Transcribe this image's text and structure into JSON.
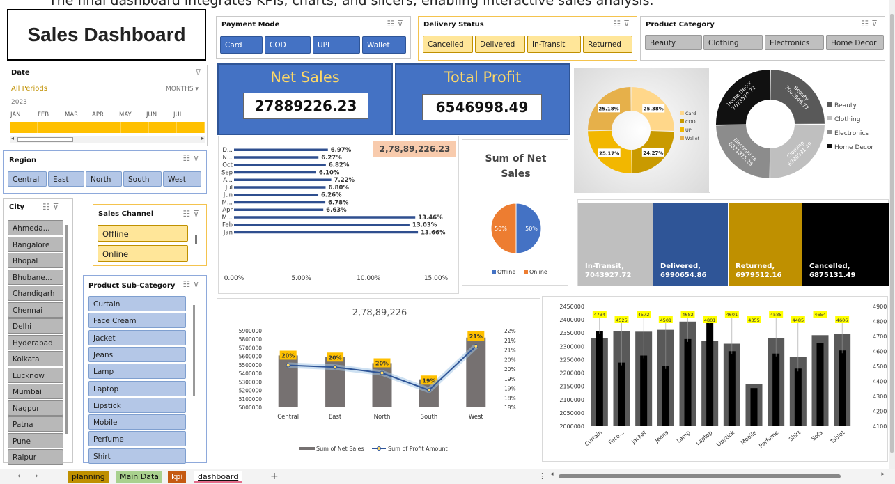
{
  "caption": "The final dashboard integrates KPIs, charts, and slicers, enabling interactive sales analysis.",
  "title": "Sales Dashboard",
  "date_slicer": {
    "title": "Date",
    "all_periods": "All Periods",
    "unit": "MONTHS",
    "year": "2023",
    "months": [
      "JAN",
      "FEB",
      "MAR",
      "APR",
      "MAY",
      "JUN",
      "JUL"
    ]
  },
  "region": {
    "title": "Region",
    "items": [
      "Central",
      "East",
      "North",
      "South",
      "West"
    ]
  },
  "city": {
    "title": "City",
    "items": [
      "Ahmeda...",
      "Bangalore",
      "Bhopal",
      "Bhubane...",
      "Chandigarh",
      "Chennai",
      "Delhi",
      "Hyderabad",
      "Kolkata",
      "Lucknow",
      "Mumbai",
      "Nagpur",
      "Patna",
      "Pune",
      "Raipur"
    ]
  },
  "sales_channel": {
    "title": "Sales Channel",
    "items": [
      "Offline",
      "Online"
    ]
  },
  "sub_category": {
    "title": "Product Sub-Category",
    "items": [
      "Curtain",
      "Face Cream",
      "Jacket",
      "Jeans",
      "Lamp",
      "Laptop",
      "Lipstick",
      "Mobile",
      "Perfume",
      "Shirt"
    ]
  },
  "payment_mode": {
    "title": "Payment Mode",
    "items": [
      "Card",
      "COD",
      "UPI",
      "Wallet"
    ]
  },
  "delivery_status": {
    "title": "Delivery Status",
    "items": [
      "Cancelled",
      "Delivered",
      "In-Transit",
      "Returned"
    ]
  },
  "product_category": {
    "title": "Product Category",
    "items": [
      "Beauty",
      "Clothing",
      "Electronics",
      "Home Decor"
    ]
  },
  "kpi": {
    "net_sales_label": "Net Sales",
    "net_sales_value": "27889226.23",
    "profit_label": "Total Profit",
    "profit_value": "6546998.49"
  },
  "monthly_total": "2,78,89,226.23",
  "region_total": "2,78,89,226",
  "colors": {
    "blue": "#4472c4",
    "gold": "#ffe699",
    "dark_blue": "#2f5597",
    "bar_navy": "#2f4f8f",
    "orange": "#ed7d31"
  },
  "status_tiles": [
    {
      "label": "In-Transit,",
      "value": "7043927.72",
      "color": "#bfbfbf"
    },
    {
      "label": "Delivered,",
      "value": "6990654.86",
      "color": "#2f5597"
    },
    {
      "label": "Returned,",
      "value": "6979512.16",
      "color": "#bf9000"
    },
    {
      "label": "Cancelled,",
      "value": "6875131.49",
      "color": "#000000"
    }
  ],
  "tabs": [
    "planning",
    "Main Data",
    "kpi",
    "dashboard",
    "+"
  ],
  "chart_data": [
    {
      "type": "bar",
      "orientation": "horizontal",
      "title": "",
      "categories": [
        "Jan",
        "Feb",
        "M...",
        "Apr",
        "M...",
        "Jun",
        "Jul",
        "A...",
        "Sep",
        "Oct",
        "N...",
        "D..."
      ],
      "values": [
        13.66,
        13.03,
        13.46,
        6.63,
        6.78,
        6.26,
        6.8,
        7.22,
        6.1,
        6.82,
        6.27,
        6.97
      ],
      "value_labels": [
        "13.66%",
        "13.03%",
        "13.46%",
        "6.63%",
        "6.78%",
        "6.26%",
        "6.80%",
        "7.22%",
        "6.10%",
        "6.82%",
        "6.27%",
        "6.97%"
      ],
      "xlim": [
        0,
        15
      ],
      "xticks": [
        "0.00%",
        "5.00%",
        "10.00%",
        "15.00%"
      ]
    },
    {
      "type": "pie",
      "title": "Sum of Net Sales",
      "slices": [
        {
          "name": "Offline",
          "value": 50,
          "label": "50%"
        },
        {
          "name": "Online",
          "value": 50,
          "label": "50%"
        }
      ],
      "legend": "bottom"
    },
    {
      "type": "pie",
      "variant": "doughnut",
      "title": "",
      "slices": [
        {
          "name": "Card",
          "value": 25.38,
          "label": "25.38%"
        },
        {
          "name": "COD",
          "value": 24.27,
          "label": "24.27%"
        },
        {
          "name": "UPI",
          "value": 25.17,
          "label": "25.17%"
        },
        {
          "name": "Wallet",
          "value": 25.18,
          "label": "25.18%"
        }
      ],
      "legend": "right"
    },
    {
      "type": "pie",
      "variant": "doughnut",
      "title": "",
      "slices": [
        {
          "name": "Beauty",
          "value": 7002846.77,
          "label": "Beauty, 7002846.77"
        },
        {
          "name": "Clothing",
          "value": 6980931.49,
          "label": "Clothing, 6980931.49"
        },
        {
          "name": "Electronics",
          "value": 6831875.25,
          "label": "Electroni cs, 6831875.25"
        },
        {
          "name": "Home Decor",
          "value": 7073570.72,
          "label": "Home Decor, 7073570.72"
        }
      ],
      "legend": "right"
    },
    {
      "type": "bar",
      "combo": "line",
      "title": "2,78,89,226",
      "categories": [
        "Central",
        "East",
        "North",
        "South",
        "West"
      ],
      "series": [
        {
          "name": "Sum of Net Sales",
          "type": "bar",
          "values": [
            5610000,
            5590000,
            5520000,
            5330000,
            5820000
          ]
        },
        {
          "name": "Sum of Profit Amount",
          "type": "line",
          "axis": "secondary",
          "values": [
            20.2,
            20.1,
            19.8,
            18.9,
            21.2
          ],
          "labels": [
            "20%",
            "20%",
            "20%",
            "19%",
            "21%"
          ]
        }
      ],
      "ylim": [
        5000000,
        5900000
      ],
      "yticks": [
        "5000000",
        "5100000",
        "5200000",
        "5300000",
        "5400000",
        "5500000",
        "5600000",
        "5700000",
        "5800000",
        "5900000"
      ],
      "y2lim": [
        18,
        22
      ],
      "y2ticks": [
        "18%",
        "18%",
        "19%",
        "19%",
        "20%",
        "20%",
        "21%",
        "21%",
        "22%"
      ],
      "legend": "bottom"
    },
    {
      "type": "bar",
      "combo": "bar",
      "title": "",
      "categories": [
        "Curtain",
        "Face...",
        "Jacket",
        "Jeans",
        "Lamp",
        "Laptop",
        "Lipstick",
        "Mobile",
        "Perfume",
        "Shirt",
        "Sofa",
        "Tablet"
      ],
      "series": [
        {
          "name": "grey",
          "axis": "primary",
          "values": [
            2330000,
            2357000,
            2355000,
            2362000,
            2393000,
            2320000,
            2310000,
            2157000,
            2330000,
            2260000,
            2342000,
            2346000
          ]
        },
        {
          "name": "black",
          "axis": "secondary",
          "values": [
            4734,
            4525,
            4572,
            4501,
            4682,
            4801,
            4601,
            4355,
            4585,
            4485,
            4654,
            4606
          ],
          "labels": [
            "4734",
            "4525",
            "4572",
            "4501",
            "4682",
            "4801",
            "4601",
            "4355",
            "4585",
            "4485",
            "4654",
            "4606"
          ]
        }
      ],
      "ylim": [
        2000000,
        2450000
      ],
      "yticks": [
        "2000000",
        "2050000",
        "2100000",
        "2150000",
        "2200000",
        "2250000",
        "2300000",
        "2350000",
        "2400000",
        "2450000"
      ],
      "y2lim": [
        4100,
        4900
      ],
      "y2ticks": [
        "4100",
        "4200",
        "4300",
        "4400",
        "4500",
        "4600",
        "4700",
        "4800",
        "4900"
      ]
    }
  ]
}
